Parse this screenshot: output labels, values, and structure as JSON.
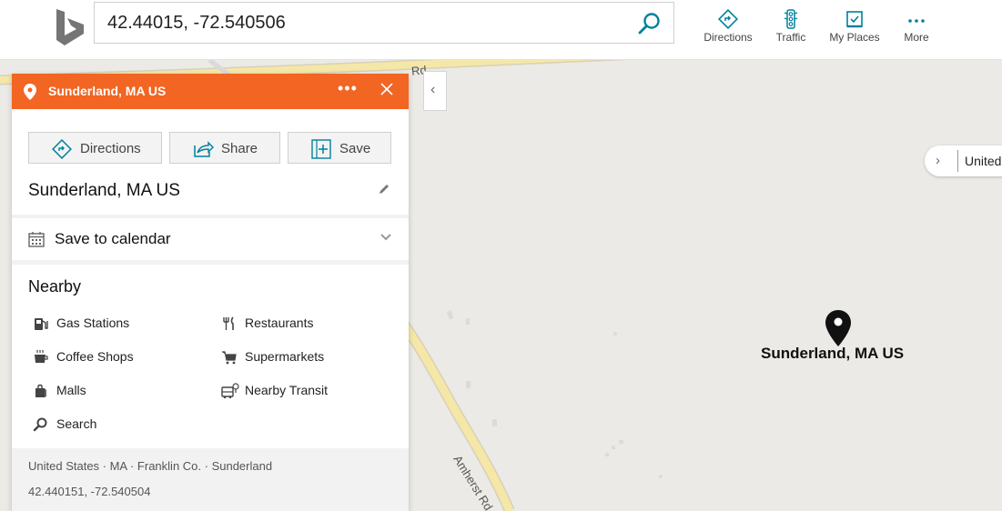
{
  "search": {
    "value": "42.44015, -72.540506"
  },
  "nav": {
    "directions": "Directions",
    "traffic": "Traffic",
    "my_places": "My Places",
    "more": "More"
  },
  "map": {
    "road_top": "Rd",
    "road_amherst": "Amherst Rd",
    "region_pill": "United",
    "pin_label": "Sunderland, MA US"
  },
  "panel": {
    "title": "Sunderland, MA US",
    "actions": {
      "directions": "Directions",
      "share": "Share",
      "save": "Save"
    },
    "place_name": "Sunderland, MA US",
    "calendar": "Save to calendar",
    "nearby_title": "Nearby",
    "nearby": [
      {
        "label": "Gas Stations",
        "icon": "gas-station-icon"
      },
      {
        "label": "Restaurants",
        "icon": "restaurant-icon"
      },
      {
        "label": "Coffee Shops",
        "icon": "coffee-icon"
      },
      {
        "label": "Supermarkets",
        "icon": "cart-icon"
      },
      {
        "label": "Malls",
        "icon": "shopping-bag-icon"
      },
      {
        "label": "Nearby Transit",
        "icon": "bus-icon"
      },
      {
        "label": "Search",
        "icon": "search-icon"
      }
    ],
    "breadcrumb": "United States · MA · Franklin Co. · Sunderland",
    "coords": "42.440151, -72.540504"
  },
  "colors": {
    "accent_orange": "#f26522",
    "brand_teal": "#00809d",
    "map_background": "#ebeae6",
    "road_yellow": "#f5e7a8"
  }
}
